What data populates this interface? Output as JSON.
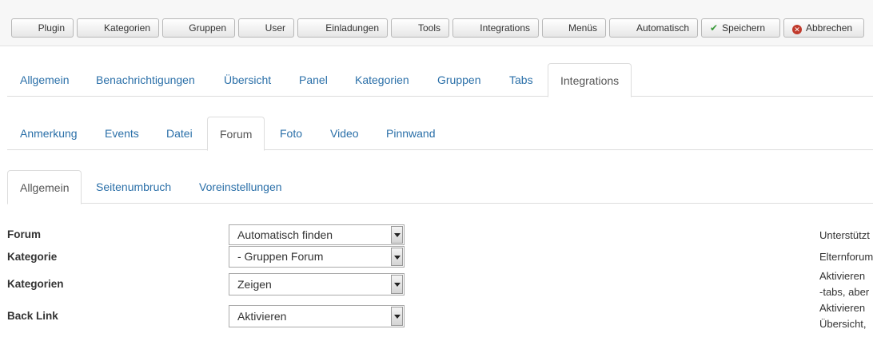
{
  "toolbar": {
    "buttons": [
      {
        "label": "Plugin"
      },
      {
        "label": "Kategorien"
      },
      {
        "label": "Gruppen"
      },
      {
        "label": "User"
      },
      {
        "label": "Einladungen"
      },
      {
        "label": "Tools"
      },
      {
        "label": "Integrations"
      },
      {
        "label": "Menüs"
      },
      {
        "label": "Automatisch"
      }
    ],
    "save_label": "Speichern",
    "cancel_label": "Abbrechen",
    "save_icon": "check-icon",
    "cancel_icon": "cancel-icon",
    "save_icon_color": "#3a9a3a",
    "cancel_icon_color": "#c0392b"
  },
  "main_tabs": {
    "items": [
      "Allgemein",
      "Benachrichtigungen",
      "Übersicht",
      "Panel",
      "Kategorien",
      "Gruppen",
      "Tabs",
      "Integrations"
    ],
    "active": "Integrations"
  },
  "integration_tabs": {
    "items": [
      "Anmerkung",
      "Events",
      "Datei",
      "Forum",
      "Foto",
      "Video",
      "Pinnwand"
    ],
    "active": "Forum"
  },
  "forum_tabs": {
    "items": [
      "Allgemein",
      "Seitenumbruch",
      "Voreinstellungen"
    ],
    "active": "Allgemein"
  },
  "form": {
    "rows": [
      {
        "label": "Forum",
        "value": "Automatisch finden",
        "desc": [
          "Unterstützt"
        ]
      },
      {
        "label": "Kategorie",
        "value": "- Gruppen Forum",
        "desc": [
          "Elternforum"
        ]
      },
      {
        "label": "Kategorien",
        "value": "Zeigen",
        "desc": [
          "Aktivieren",
          "-tabs, aber"
        ]
      },
      {
        "label": "Back Link",
        "value": "Aktivieren",
        "desc": [
          "Aktivieren",
          "Übersicht,"
        ]
      }
    ]
  },
  "colors": {
    "link": "#2a6fa8",
    "toolbar_bg": "#f7f7f7"
  }
}
